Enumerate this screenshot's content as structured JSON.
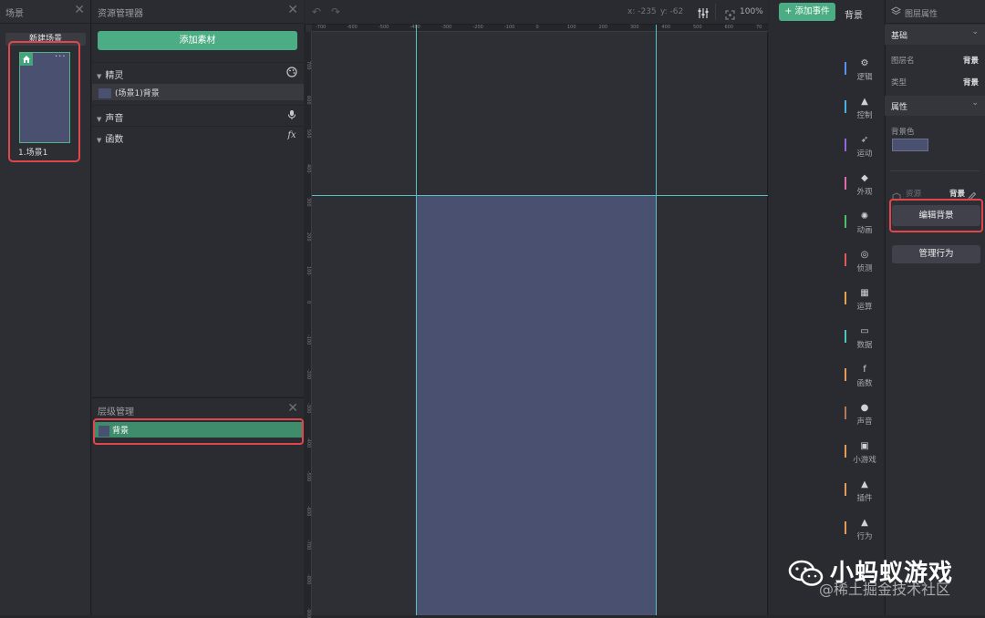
{
  "scene_panel": {
    "title": "场景",
    "close": "✕",
    "new_scene": "新建场景",
    "more": "···",
    "scene_label": "1.场景1"
  },
  "resource_panel": {
    "title": "资源管理器",
    "close": "✕",
    "add_material": "添加素材",
    "sections": {
      "sprites": "精灵",
      "sounds": "声音",
      "functions": "函数"
    },
    "sprite_item": "(场景1)背景",
    "icons": {
      "sprites": "palette-icon",
      "sounds": "microphone-icon",
      "functions": "fx-icon"
    }
  },
  "layer_panel": {
    "title": "层级管理",
    "close": "✕",
    "row": "背景"
  },
  "canvas": {
    "coord_x": "x: -235",
    "coord_y": "y: -62",
    "zoom": "100%",
    "top_ruler": [
      "-700",
      "-600",
      "-500",
      "-400",
      "-300",
      "-200",
      "-100",
      "0",
      "100",
      "200",
      "300",
      "400",
      "500",
      "600",
      "70"
    ],
    "left_ruler": [
      "700",
      "600",
      "500",
      "400",
      "300",
      "200",
      "100",
      "0",
      "-100",
      "-200",
      "-300",
      "-400",
      "-500",
      "-600",
      "-700",
      "-800",
      "-900"
    ]
  },
  "events": {
    "add_event": "+ 添加事件",
    "layer_label": "背景",
    "categories": [
      {
        "label": "逻辑",
        "icon": "logic-icon",
        "color": "#5b8ff0"
      },
      {
        "label": "控制",
        "icon": "control-icon",
        "color": "#4fb0e0"
      },
      {
        "label": "运动",
        "icon": "motion-icon",
        "color": "#8e6bd9"
      },
      {
        "label": "外观",
        "icon": "appearance-icon",
        "color": "#e06cab"
      },
      {
        "label": "动画",
        "icon": "animation-icon",
        "color": "#4fbf6a"
      },
      {
        "label": "侦测",
        "icon": "sensing-icon",
        "color": "#e05a5a"
      },
      {
        "label": "运算",
        "icon": "operator-icon",
        "color": "#e0a34f"
      },
      {
        "label": "数据",
        "icon": "data-icon",
        "color": "#4fc5b8"
      },
      {
        "label": "函数",
        "icon": "function-icon",
        "color": "#e39a5a"
      },
      {
        "label": "声音",
        "icon": "sound-icon",
        "color": "#b07a5a"
      },
      {
        "label": "小游戏",
        "icon": "minigame-icon",
        "color": "#e39a5a"
      },
      {
        "label": "插件",
        "icon": "plugin-icon",
        "color": "#e39a5a"
      },
      {
        "label": "行为",
        "icon": "behavior-icon",
        "color": "#e39a5a"
      }
    ]
  },
  "props_panel": {
    "title": "图层属性",
    "basic": "基础",
    "layer_name_key": "图层名",
    "layer_name_val": "背景",
    "type_key": "类型",
    "type_val": "背景",
    "attributes": "属性",
    "bg_color_key": "背景色",
    "bg_color": "#4a5170",
    "resource_key": "资源",
    "resource_val": "背景",
    "edit_bg": "编辑背景",
    "manage_behavior": "管理行为"
  },
  "watermark": {
    "title": "小蚂蚁游戏",
    "subtitle": "@稀土掘金技术社区"
  }
}
